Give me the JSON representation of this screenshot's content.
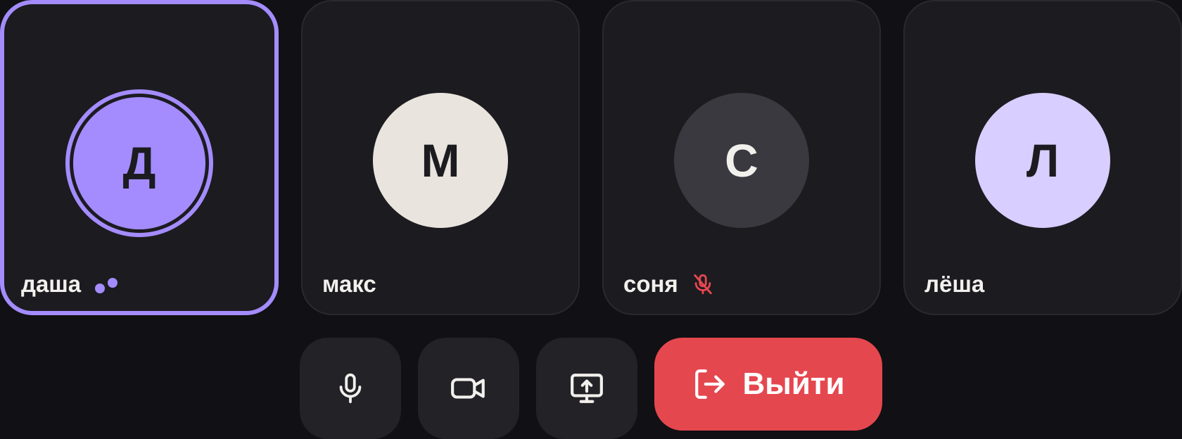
{
  "participants": [
    {
      "name": "даша",
      "initial": "Д",
      "avatar_color": "#a48cff",
      "initial_color": "#1c1b20",
      "speaking": true,
      "muted": false
    },
    {
      "name": "макс",
      "initial": "М",
      "avatar_color": "#e9e5de",
      "initial_color": "#1c1b20",
      "speaking": false,
      "muted": false
    },
    {
      "name": "соня",
      "initial": "С",
      "avatar_color": "#3a393f",
      "initial_color": "#f2f0ec",
      "speaking": false,
      "muted": true
    },
    {
      "name": "лёша",
      "initial": "Л",
      "avatar_color": "#d8ceff",
      "initial_color": "#1c1b20",
      "speaking": false,
      "muted": false
    }
  ],
  "controls": {
    "mic_icon": "microphone-icon",
    "camera_icon": "video-camera-icon",
    "share_icon": "screen-share-icon",
    "leave_icon": "exit-icon",
    "leave_label": "Выйти"
  },
  "colors": {
    "accent": "#a48cff",
    "danger": "#e5474f",
    "tile_bg": "#1c1b20",
    "page_bg": "#111014"
  }
}
